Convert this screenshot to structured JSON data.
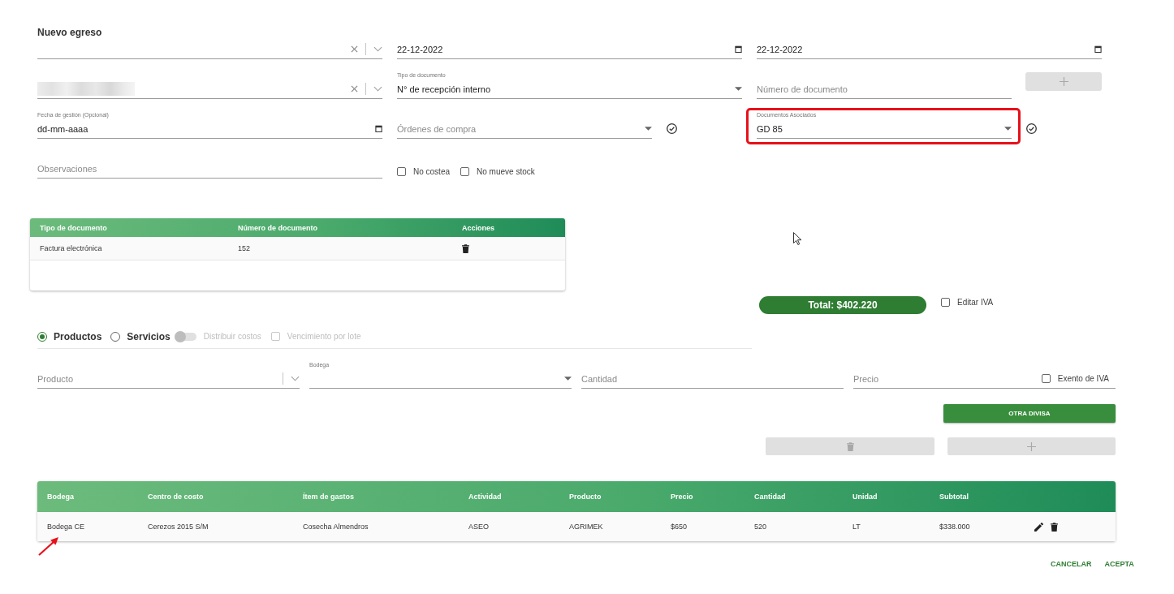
{
  "title": "Nuevo egreso",
  "form_rows": [
    {
      "fields": [
        {
          "kind": "autocomplete",
          "clearable": true
        },
        {
          "kind": "date",
          "value": "22-12-2022"
        },
        {
          "kind": "date",
          "value": "22-12-2022"
        }
      ]
    },
    {
      "fields": [
        {
          "kind": "autocomplete",
          "clearable": true,
          "redacted": true
        },
        {
          "kind": "select",
          "label": "Tipo de documento",
          "value": "N° de recepción interno"
        },
        {
          "kind": "text",
          "placeholder": "Número de documento",
          "add_button": {
            "disabled": true
          }
        }
      ]
    },
    {
      "fields": [
        {
          "kind": "date",
          "label": "Fecha de gestión (Opcional)",
          "placeholder": "dd-mm-aaaa"
        },
        {
          "kind": "select",
          "placeholder": "Órdenes de compra",
          "confirm": true
        },
        {
          "kind": "select",
          "label": "Documentos Asociados",
          "value": "GD 85",
          "confirm": true,
          "highlighted": true
        }
      ]
    },
    {
      "fields": [
        {
          "kind": "text",
          "placeholder": "Observaciones"
        },
        {
          "kind": "checkboxes",
          "items": [
            {
              "label": "No costea",
              "checked": false
            },
            {
              "label": "No mueve stock",
              "checked": false
            }
          ]
        }
      ]
    }
  ],
  "documents_table": {
    "columns": [
      "Tipo de documento",
      "Número de documento",
      "Acciones"
    ],
    "rows": [
      {
        "cells": [
          "Factura electrónica",
          "152"
        ],
        "actions": [
          {
            "kind": "delete"
          }
        ]
      }
    ]
  },
  "total": {
    "text": "Total: $402.220"
  },
  "edit_iva": {
    "label": "Editar IVA",
    "checked": false
  },
  "item_type": [
    {
      "label": "Productos",
      "selected": true
    },
    {
      "label": "Servicios",
      "selected": false
    }
  ],
  "distribute_costs": {
    "label": "Distribuir costos",
    "on": false,
    "disabled": true
  },
  "lot_expiry": {
    "label": "Vencimiento por lote",
    "checked": false,
    "disabled": true
  },
  "product_fields": [
    {
      "kind": "autocomplete",
      "placeholder": "Producto",
      "clearable": false
    },
    {
      "kind": "select",
      "label": "Bodega"
    },
    {
      "kind": "text",
      "placeholder": "Cantidad"
    },
    {
      "kind": "text",
      "placeholder": "Precio",
      "checkbox": {
        "label": "Exento de IVA",
        "checked": false
      }
    }
  ],
  "other_currency_button": {
    "label": "OTRA DIVISA"
  },
  "item_buttons": [
    {
      "kind": "delete",
      "disabled": true
    },
    {
      "kind": "add",
      "disabled": true
    }
  ],
  "items_table": {
    "columns": [
      "Bodega",
      "Centro de costo",
      "Ítem de gastos",
      "Actividad",
      "Producto",
      "Precio",
      "Cantidad",
      "Unidad",
      "Subtotal"
    ],
    "rows": [
      {
        "cells": [
          "Bodega CE",
          "Cerezos 2015 S/M",
          "Cosecha Almendros",
          "ASEO",
          "AGRIMEK",
          "$650",
          "520",
          "LT",
          "$338.000"
        ],
        "actions": [
          {
            "kind": "edit"
          },
          {
            "kind": "delete"
          }
        ],
        "annotated": true
      }
    ]
  },
  "footer_buttons": [
    {
      "label": "CANCELAR"
    },
    {
      "label": "ACEPTA"
    }
  ]
}
